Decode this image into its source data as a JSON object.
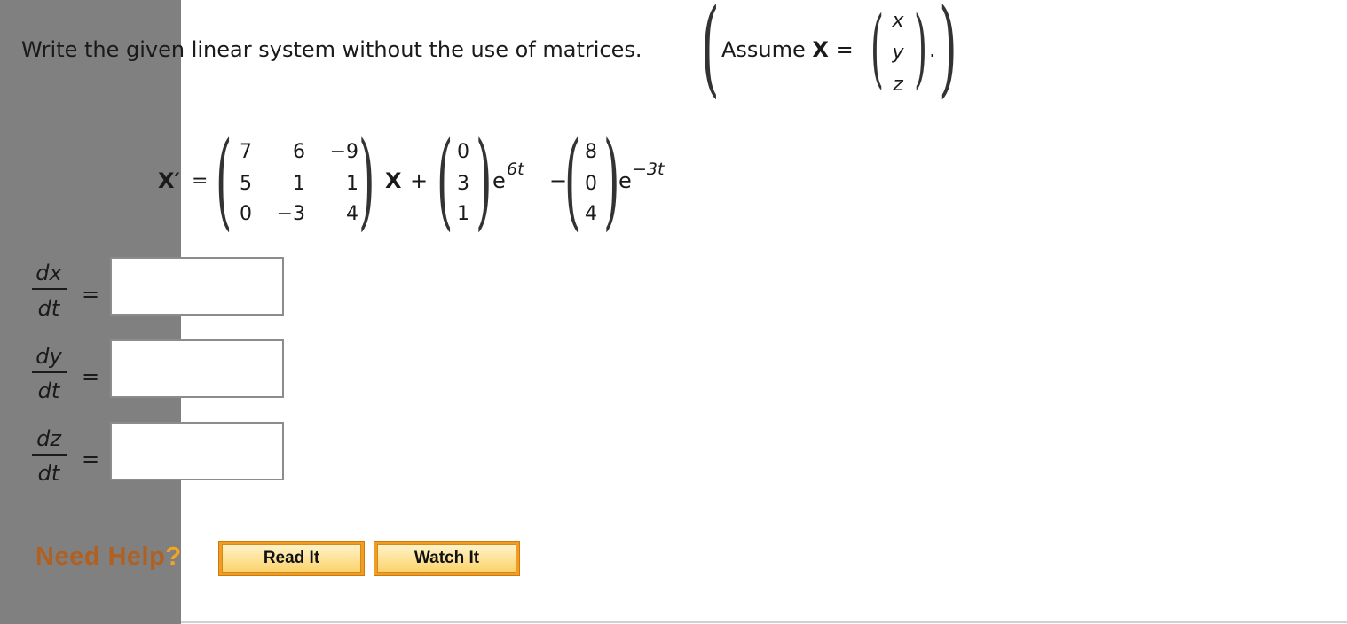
{
  "question": {
    "prompt": "Write the given linear system without the use of matrices.",
    "assume_label": "Assume",
    "assume_var": "X",
    "equals": "=",
    "period": ".",
    "vector": [
      "x",
      "y",
      "z"
    ]
  },
  "system": {
    "lhs": "X′",
    "equals": "=",
    "matrix": [
      [
        "7",
        "6",
        "−9"
      ],
      [
        "5",
        "1",
        "1"
      ],
      [
        "0",
        "−3",
        "4"
      ]
    ],
    "times_var": "X",
    "plus": "+",
    "vec1": [
      "0",
      "3",
      "1"
    ],
    "exp1_base": "e",
    "exp1_power": "6t",
    "minus": "−",
    "vec2": [
      "8",
      "0",
      "4"
    ],
    "exp2_base": "e",
    "exp2_power": "−3t"
  },
  "answers": [
    {
      "num": "dx",
      "den": "dt",
      "eq": "=",
      "value": ""
    },
    {
      "num": "dy",
      "den": "dt",
      "eq": "=",
      "value": ""
    },
    {
      "num": "dz",
      "den": "dt",
      "eq": "=",
      "value": ""
    }
  ],
  "help": {
    "label": "Need Help",
    "qmark": "?",
    "read_it": "Read It",
    "watch_it": "Watch It"
  }
}
